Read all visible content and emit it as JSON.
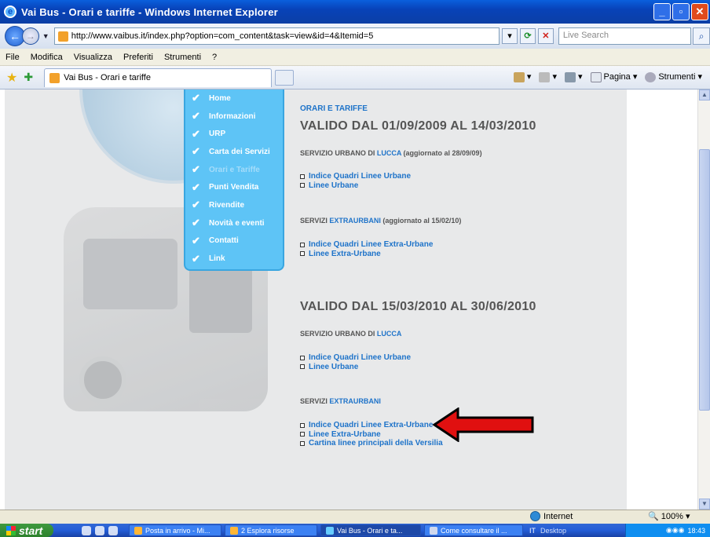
{
  "window": {
    "title": "Vai Bus - Orari e tariffe - Windows Internet Explorer"
  },
  "address": {
    "url": "http://www.vaibus.it/index.php?option=com_content&task=view&id=4&Itemid=5",
    "search_placeholder": "Live Search"
  },
  "menubar": [
    "File",
    "Modifica",
    "Visualizza",
    "Preferiti",
    "Strumenti",
    "?"
  ],
  "tab": {
    "title": "Vai Bus - Orari e tariffe"
  },
  "commands": {
    "page": "Pagina",
    "tools": "Strumenti"
  },
  "site_menu": [
    "Home",
    "Informazioni",
    "URP",
    "Carta dei Servizi",
    "Orari e Tariffe",
    "Punti Vendita",
    "Rivendite",
    "Novità e eventi",
    "Contatti",
    "Link"
  ],
  "site_menu_active": "Orari e Tariffe",
  "content": {
    "section_title": "ORARI E TARIFFE",
    "p1": {
      "heading": "VALIDO DAL 01/09/2009 AL 14/03/2010",
      "urban_prefix": "SERVIZIO URBANO DI ",
      "urban_city": "LUCCA",
      "urban_suffix": " (aggiornato al 28/09/09)",
      "urban_links": [
        "Indice Quadri Linee Urbane",
        "Linee Urbane"
      ],
      "extra_prefix": "SERVIZI ",
      "extra_city": "EXTRAURBANI",
      "extra_suffix": " (aggiornato al 15/02/10)",
      "extra_links": [
        "Indice Quadri Linee Extra-Urbane",
        "Linee Extra-Urbane"
      ]
    },
    "p2": {
      "heading": "VALIDO DAL 15/03/2010 AL 30/06/2010",
      "urban_prefix": "SERVIZIO URBANO DI ",
      "urban_city": "LUCCA",
      "urban_links": [
        "Indice Quadri Linee Urbane",
        "Linee Urbane"
      ],
      "extra_prefix": "SERVIZI ",
      "extra_city": "EXTRAURBANI",
      "extra_links": [
        "Indice Quadri Linee Extra-Urbane",
        "Linee Extra-Urbane",
        "Cartina linee principali della Versilia"
      ]
    }
  },
  "status": {
    "zone": "Internet",
    "zoom": "100%"
  },
  "taskbar": {
    "start": "start",
    "items": [
      "Posta in arrivo - Mi...",
      "2 Esplora risorse",
      "Vai Bus - Orari e ta...",
      "Come consultare il ..."
    ],
    "lang": "IT",
    "desktop": "Desktop",
    "clock": "18:43"
  },
  "colors": {
    "link": "#1e73c9",
    "menu": "#5ec4f6",
    "arrow": "#e01010"
  }
}
